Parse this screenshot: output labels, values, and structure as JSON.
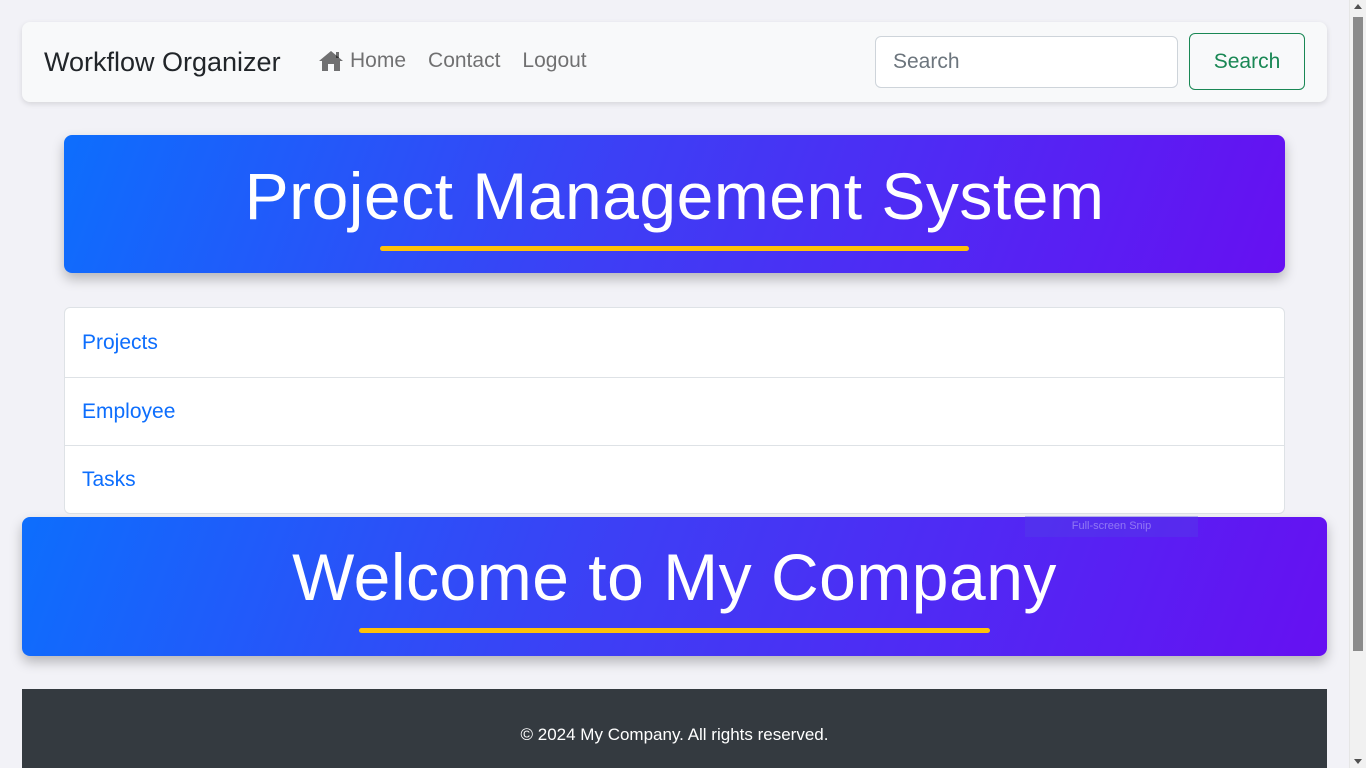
{
  "navbar": {
    "brand": "Workflow Organizer",
    "links": [
      {
        "label": "Home",
        "icon": "home-icon"
      },
      {
        "label": "Contact"
      },
      {
        "label": "Logout"
      }
    ],
    "search_placeholder": "Search",
    "search_value": "",
    "search_button": "Search"
  },
  "hero_top": {
    "title": "Project Management System"
  },
  "menu": {
    "items": [
      "Projects",
      "Employee",
      "Tasks"
    ]
  },
  "overlay": {
    "snip_label": "Full-screen Snip"
  },
  "hero_bottom": {
    "title": "Welcome to My Company"
  },
  "footer": {
    "text": "© 2024 My Company. All rights reserved."
  },
  "colors": {
    "accent_blue": "#0d6efd",
    "accent_purple": "#6610f2",
    "underline_yellow": "#ffc107",
    "success_green": "#198754",
    "footer_dark": "#343a40"
  }
}
